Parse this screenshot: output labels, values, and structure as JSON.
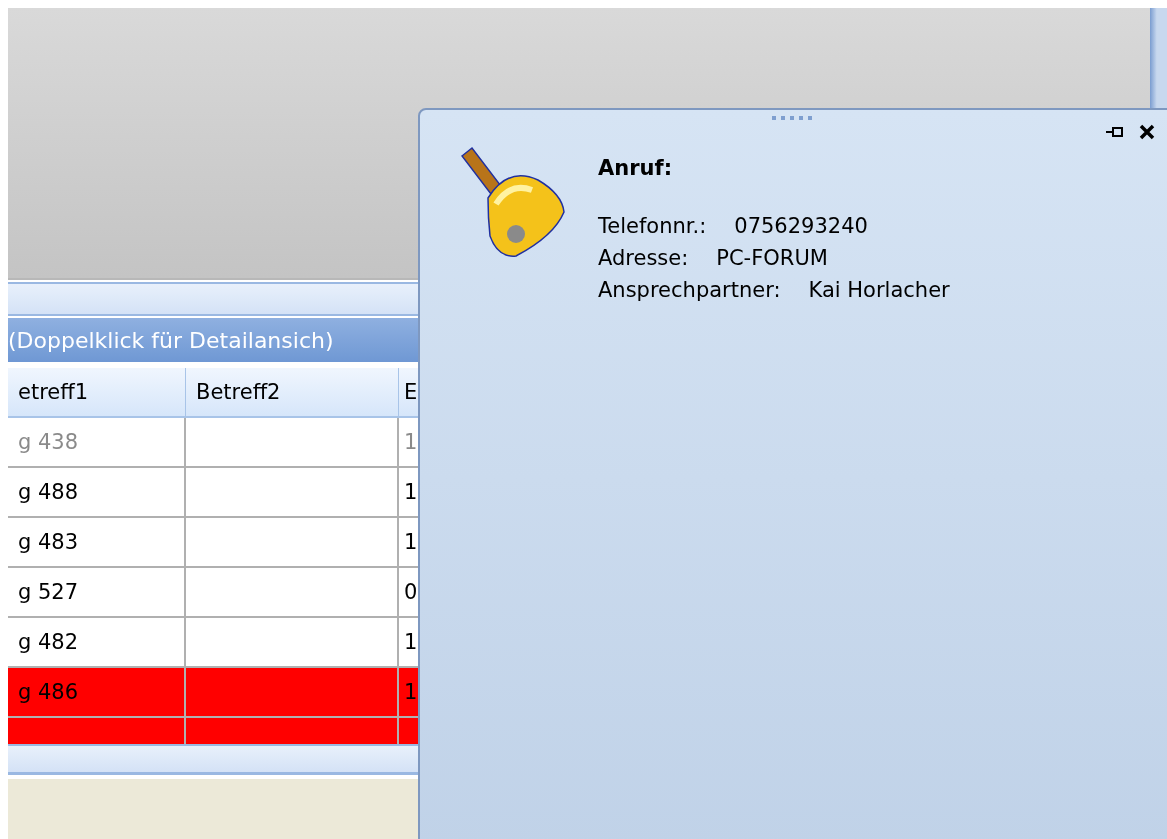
{
  "grid": {
    "caption": "(Doppelklick für Detailansich)",
    "columns": [
      "etreff1",
      "Betreff2",
      "E"
    ],
    "rows": [
      {
        "cells": [
          "g 438",
          "",
          "1"
        ],
        "dimmed": true,
        "highlighted": false
      },
      {
        "cells": [
          "g 488",
          "",
          "1"
        ],
        "dimmed": false,
        "highlighted": false
      },
      {
        "cells": [
          "g 483",
          "",
          "1"
        ],
        "dimmed": false,
        "highlighted": false
      },
      {
        "cells": [
          "g 527",
          "",
          "0"
        ],
        "dimmed": false,
        "highlighted": false
      },
      {
        "cells": [
          "g 482",
          "",
          "1"
        ],
        "dimmed": false,
        "highlighted": false
      },
      {
        "cells": [
          "g 486",
          "",
          "1"
        ],
        "dimmed": false,
        "highlighted": true
      },
      {
        "dimmed": false,
        "highlighted": true
      }
    ]
  },
  "popup": {
    "title": "Anruf:",
    "fields": [
      {
        "label": "Telefonnr.:",
        "value": "0756293240"
      },
      {
        "label": "Adresse:",
        "value": "PC-FORUM"
      },
      {
        "label": "Ansprechpartner:",
        "value": "Kai Horlacher"
      }
    ]
  }
}
